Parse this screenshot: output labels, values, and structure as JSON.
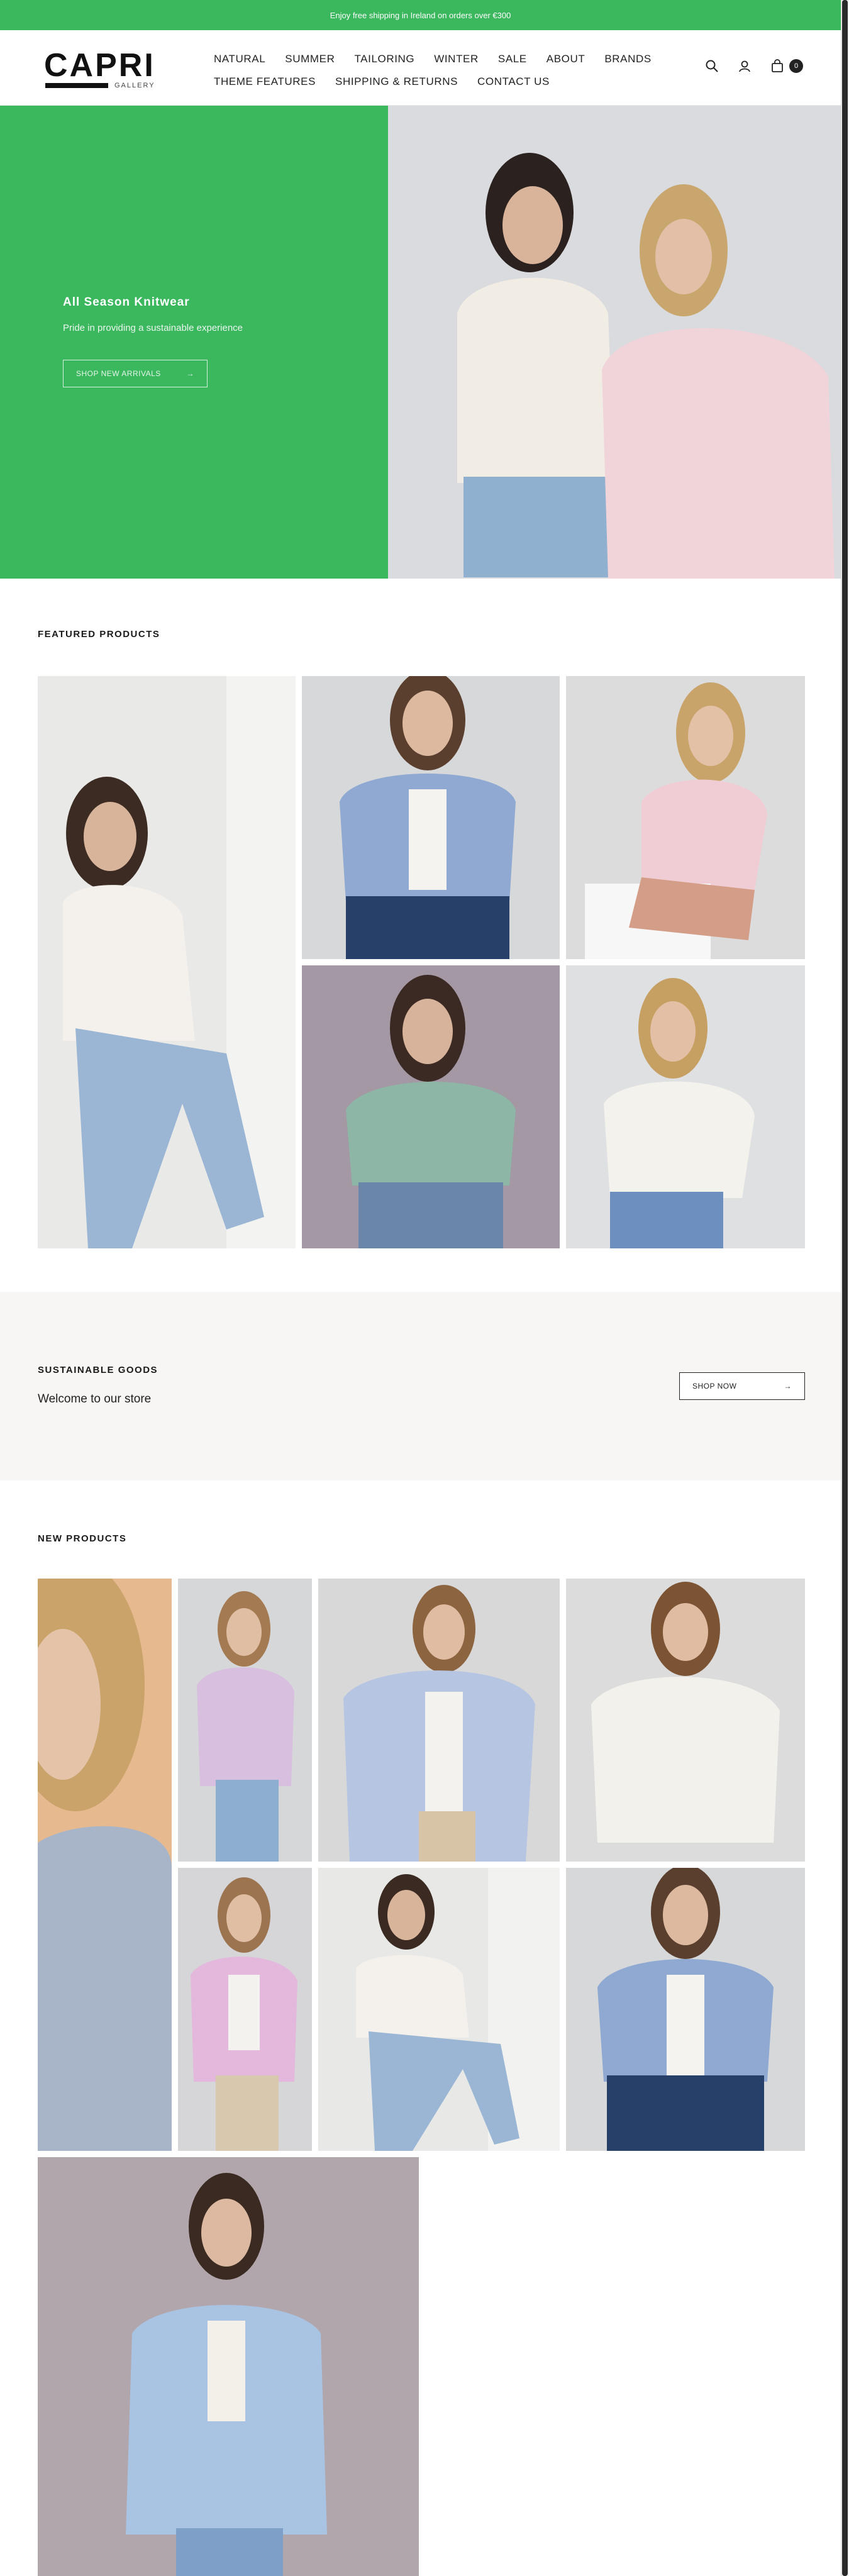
{
  "announcement": "Enjoy free shipping in Ireland on orders over €300",
  "logo": {
    "word": "CAPRI",
    "sub": "GALLERY"
  },
  "nav": {
    "row1": [
      "NATURAL",
      "SUMMER",
      "TAILORING",
      "WINTER",
      "SALE",
      "ABOUT",
      "BRANDS"
    ],
    "row2": [
      "THEME FEATURES",
      "SHIPPING & RETURNS",
      "CONTACT US"
    ]
  },
  "header_icons": {
    "search": "search-icon",
    "account": "user-icon",
    "cart": "bag-icon",
    "cart_count": "0"
  },
  "hero": {
    "title": "All Season Knitwear",
    "subtitle": "Pride in providing a sustainable experience",
    "button": "SHOP NEW ARRIVALS",
    "accent": "#3bb75e"
  },
  "featured": {
    "title": "FEATURED PRODUCTS"
  },
  "band": {
    "title": "SUSTAINABLE GOODS",
    "subtitle": "Welcome to our store",
    "button": "SHOP NOW"
  },
  "new_products": {
    "title": "NEW PRODUCTS"
  }
}
